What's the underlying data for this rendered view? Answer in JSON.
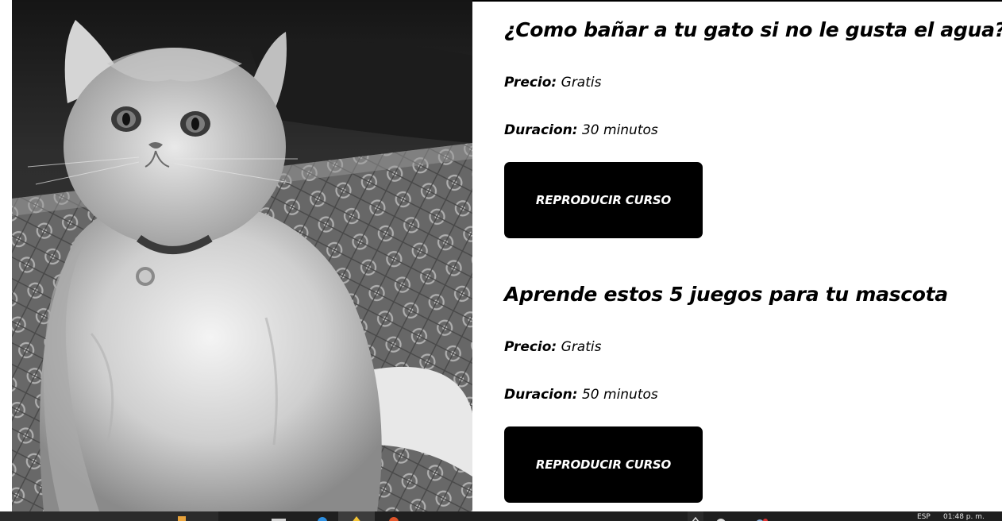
{
  "photo": {
    "alt": "Gato persa blanco y negro sentado sobre una alfombra"
  },
  "courses": [
    {
      "title": "¿Como bañar a tu gato si no le gusta el agua?",
      "price_label": "Precio:",
      "price_value": "Gratis",
      "duration_label": "Duracion:",
      "duration_value": "30 minutos",
      "button_label": "REPRODUCIR CURSO"
    },
    {
      "title": "Aprende estos 5 juegos para tu mascota",
      "price_label": "Precio:",
      "price_value": "Gratis",
      "duration_label": "Duracion:",
      "duration_value": "50 minutos",
      "button_label": "REPRODUCIR CURSO"
    }
  ],
  "taskbar": {
    "language": "ESP",
    "clock": "01:48 p. m."
  },
  "colors": {
    "button_bg": "#000000",
    "button_text": "#ffffff",
    "taskbar_bg": "#1f1f1f"
  }
}
